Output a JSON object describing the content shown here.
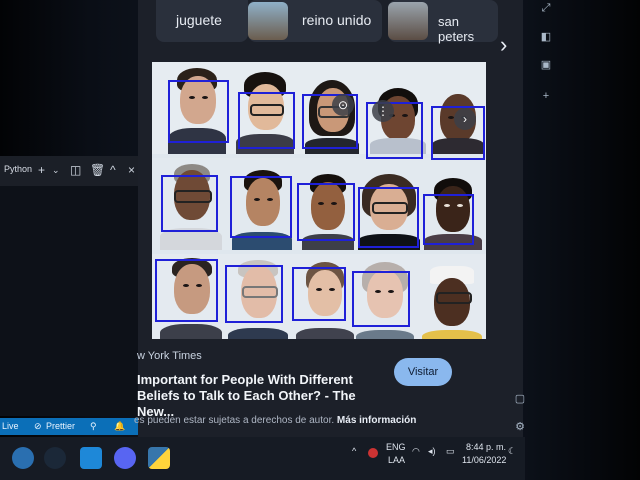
{
  "chips": [
    {
      "label": "juguete",
      "thumb_color": "#6b5a4a"
    },
    {
      "label": "reino unido",
      "thumb_color": "#587a92"
    },
    {
      "label": "san peters",
      "thumb_color": "#7a6e65"
    }
  ],
  "nav": {
    "next_icon": "chevron-right-icon"
  },
  "vscode": {
    "terminal_label": "Python",
    "status": {
      "live": "Live",
      "prettier": "Prettier"
    }
  },
  "result": {
    "source": "w York Times",
    "title_line1": "Important for People With Different",
    "title_line2": "Beliefs to Talk to Each Other? - The New...",
    "visit_label": "Visitar",
    "copyright_text": "es pueden estar sujetas a derechos de autor.",
    "more_info": "Más información"
  },
  "tray": {
    "lang": "ENG",
    "region": "LAA",
    "time": "8:44 p. m.",
    "date": "11/06/2022"
  },
  "colors": {
    "bbox": "#1f20d8",
    "accent": "#8ab8ee",
    "statusbar": "#0b6fb8"
  },
  "faces_detected": 15
}
